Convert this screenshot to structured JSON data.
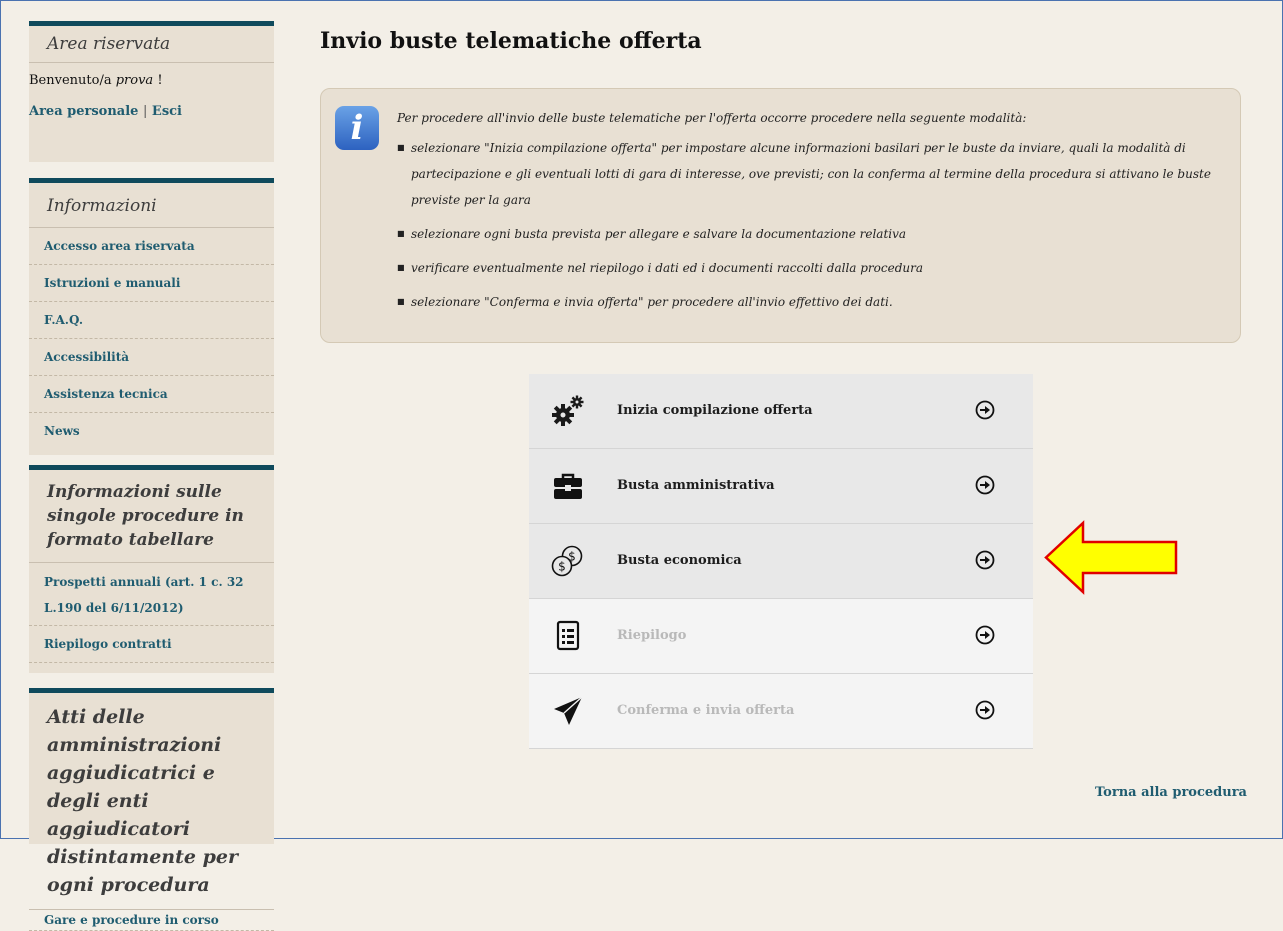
{
  "sidebar": {
    "reserved": {
      "title": "Area riservata",
      "welcome_prefix": "Benvenuto/a ",
      "welcome_user": "prova",
      "welcome_suffix": " !",
      "personal_area": "Area personale",
      "separator": "|",
      "logout": "Esci"
    },
    "info": {
      "title": "Informazioni",
      "items": [
        "Accesso area riservata",
        "Istruzioni e manuali",
        "F.A.Q.",
        "Accessibilità",
        "Assistenza tecnica",
        "News"
      ]
    },
    "tables": {
      "title": "Informazioni sulle singole procedure in formato tabellare",
      "items": [
        "Prospetti annuali (art. 1 c. 32 L.190 del 6/11/2012)",
        "Riepilogo contratti"
      ]
    },
    "acts": {
      "title": "Atti delle amministrazioni aggiudicatrici e degli enti aggiudicatori distintamente per ogni procedura",
      "items": [
        "Gare e procedure in corso"
      ]
    }
  },
  "main": {
    "title": "Invio buste telematiche offerta",
    "info": {
      "icon_letter": "i",
      "intro": "Per procedere all'invio delle buste telematiche per l'offerta occorre procedere nella seguente modalità:",
      "bullets": [
        "selezionare \"Inizia compilazione offerta\" per impostare alcune informazioni basilari per le buste da inviare, quali la modalità di partecipazione e gli eventuali lotti di gara di interesse, ove previsti; con la conferma al termine della procedura si attivano le buste previste per la gara",
        "selezionare ogni busta prevista per allegare e salvare la documentazione relativa",
        "verificare eventualmente nel riepilogo i dati ed i documenti raccolti dalla procedura",
        "selezionare \"Conferma e invia offerta\" per procedere all'invio effettivo dei dati."
      ]
    },
    "actions": [
      {
        "label": "Inizia compilazione offerta",
        "icon": "gears-icon",
        "enabled": true
      },
      {
        "label": "Busta amministrativa",
        "icon": "briefcase-icon",
        "enabled": true
      },
      {
        "label": "Busta economica",
        "icon": "coins-icon",
        "enabled": true
      },
      {
        "label": "Riepilogo",
        "icon": "document-list-icon",
        "enabled": false
      },
      {
        "label": "Conferma e invia offerta",
        "icon": "paper-plane-icon",
        "enabled": false
      }
    ],
    "back_link": "Torna alla procedura",
    "annotation_color": "#ffff00",
    "annotation_border": "#e00000"
  }
}
